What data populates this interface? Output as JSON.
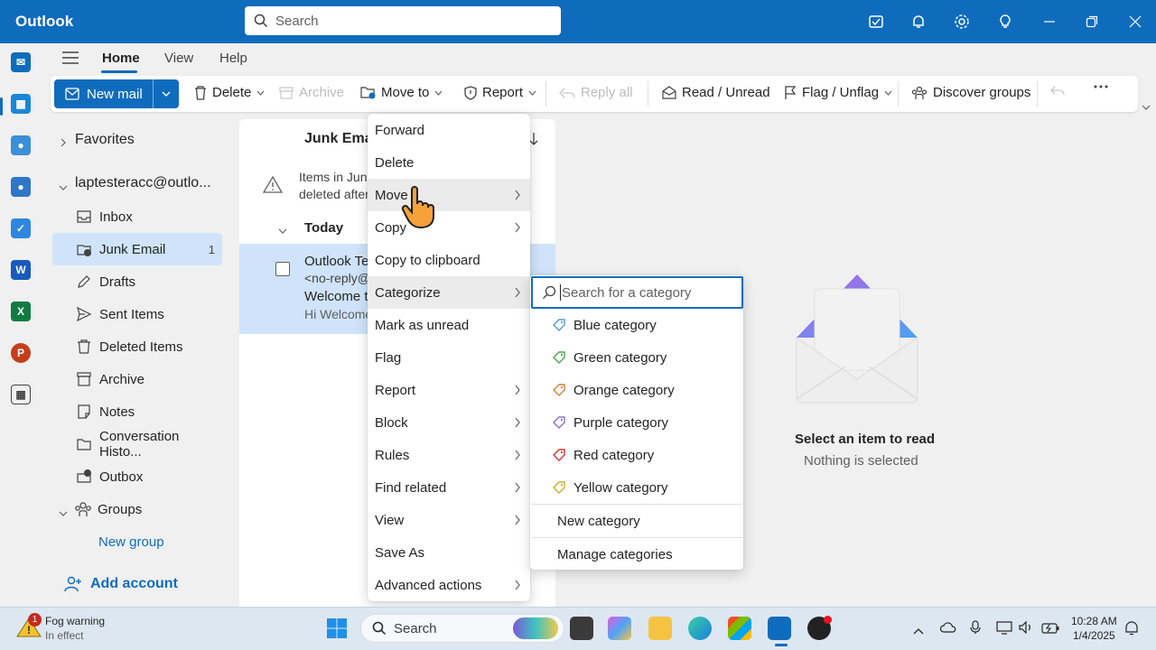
{
  "app": {
    "name": "Outlook",
    "search_placeholder": "Search"
  },
  "tabs": [
    "Home",
    "View",
    "Help"
  ],
  "ribbon": {
    "new_mail": "New mail",
    "delete": "Delete",
    "archive": "Archive",
    "move_to": "Move to",
    "report": "Report",
    "reply_all": "Reply all",
    "read_unread": "Read / Unread",
    "flag_unflag": "Flag / Unflag",
    "discover_groups": "Discover groups"
  },
  "sidebar": {
    "favorites": "Favorites",
    "account": "laptesteracc@outlo...",
    "folders": [
      {
        "label": "Inbox",
        "icon": "inbox-icon"
      },
      {
        "label": "Junk Email",
        "icon": "junk-icon",
        "count": "1"
      },
      {
        "label": "Drafts",
        "icon": "drafts-icon"
      },
      {
        "label": "Sent Items",
        "icon": "sent-icon"
      },
      {
        "label": "Deleted Items",
        "icon": "trash-icon"
      },
      {
        "label": "Archive",
        "icon": "archive-icon"
      },
      {
        "label": "Notes",
        "icon": "notes-icon"
      },
      {
        "label": "Conversation Histo...",
        "icon": "folder-icon"
      },
      {
        "label": "Outbox",
        "icon": "outbox-icon"
      }
    ],
    "groups": "Groups",
    "new_group": "New group",
    "add_account": "Add account"
  },
  "message_list": {
    "title": "Junk Emai",
    "notice_line1": "Items in Junk",
    "notice_line2": "deleted after",
    "group_today": "Today",
    "message": {
      "sender": "Outlook Tea",
      "address": "<no-reply@",
      "subject": "Welcome to",
      "preview": "Hi Welcome"
    }
  },
  "context_menu": {
    "items": [
      {
        "label": "Forward",
        "sub": false
      },
      {
        "label": "Delete",
        "sub": false
      },
      {
        "label": "Move",
        "sub": true
      },
      {
        "label": "Copy",
        "sub": true
      },
      {
        "label": "Copy to clipboard",
        "sub": false
      },
      {
        "label": "Categorize",
        "sub": true
      },
      {
        "label": "Mark as unread",
        "sub": false
      },
      {
        "label": "Flag",
        "sub": false
      },
      {
        "label": "Report",
        "sub": true
      },
      {
        "label": "Block",
        "sub": true
      },
      {
        "label": "Rules",
        "sub": true
      },
      {
        "label": "Find related",
        "sub": true
      },
      {
        "label": "View",
        "sub": true
      },
      {
        "label": "Save As",
        "sub": false
      },
      {
        "label": "Advanced actions",
        "sub": true
      }
    ]
  },
  "categorize_menu": {
    "search_placeholder": "Search for a category",
    "categories": [
      {
        "label": "Blue category",
        "color": "#4f9bd9"
      },
      {
        "label": "Green category",
        "color": "#4aa84b"
      },
      {
        "label": "Orange category",
        "color": "#e07b39"
      },
      {
        "label": "Purple category",
        "color": "#8a6fd1"
      },
      {
        "label": "Red category",
        "color": "#d13438"
      },
      {
        "label": "Yellow category",
        "color": "#c9b02a"
      }
    ],
    "new_category": "New category",
    "manage_categories": "Manage categories"
  },
  "reading_pane": {
    "title": "Select an item to read",
    "subtitle": "Nothing is selected"
  },
  "taskbar": {
    "weather_title": "Fog warning",
    "weather_sub": "In effect",
    "weather_badge": "1",
    "search": "Search",
    "time": "10:28 AM",
    "date": "1/4/2025"
  },
  "colors": {
    "brand": "#0f6cbd",
    "selected": "#cfe4fa"
  }
}
